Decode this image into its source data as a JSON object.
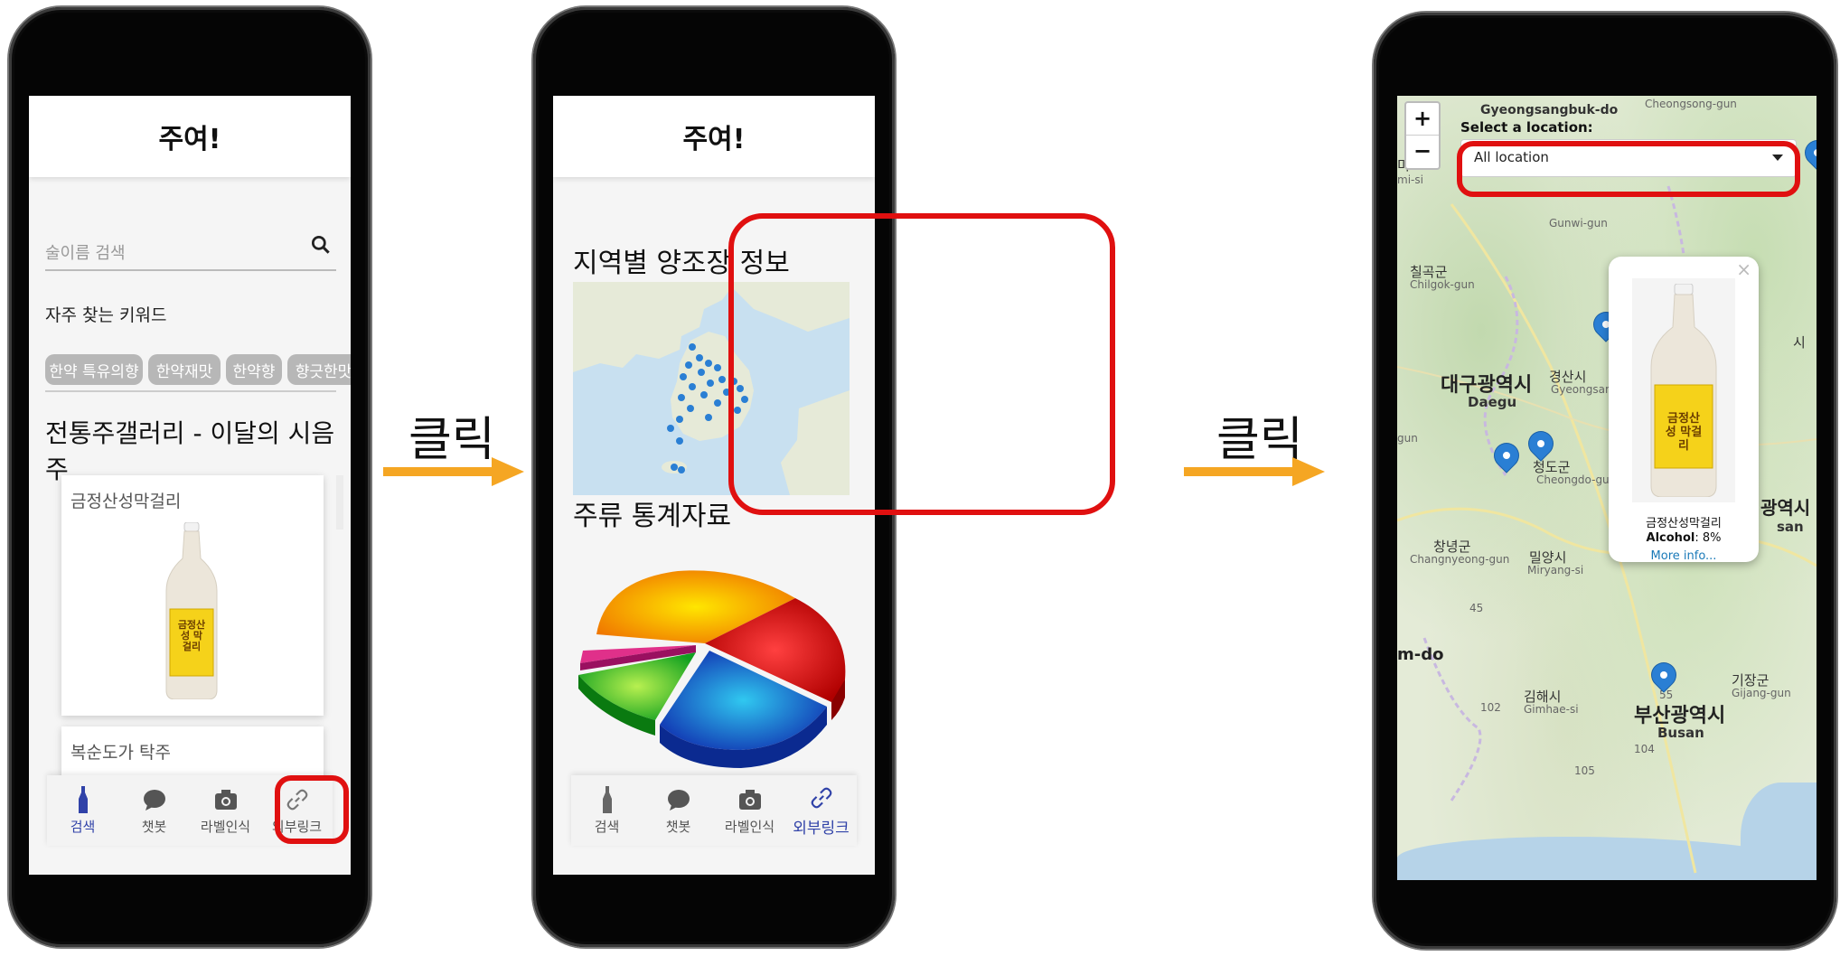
{
  "arrows": {
    "label": "클릭",
    "color": "#f5a623"
  },
  "app": {
    "title": "주여!"
  },
  "nav": {
    "search": "검색",
    "chatbot": "챗봇",
    "label_recognition": "라벨인식",
    "external_link": "외부링크"
  },
  "phone1": {
    "search_placeholder": "술이름 검색",
    "keywords_title": "자주 찾는 키워드",
    "keywords": [
      "한약 특유의향",
      "한약재맛",
      "한약향",
      "향긋한맛"
    ],
    "gallery_title": "전통주갤러리 - 이달의 시음주",
    "cards": [
      "금정산성막걸리",
      "복순도가 탁주"
    ],
    "bottle_label": "금정산성 막걸리"
  },
  "phone2": {
    "region_title": "지역별 양조장 정보",
    "stats_title": "주류 통계자료"
  },
  "phone3": {
    "zoom_in": "+",
    "zoom_out": "−",
    "select_label": "Select a location:",
    "select_value": "All location",
    "popup": {
      "name": "금정산성막걸리",
      "alcohol_label": "Alcohol",
      "alcohol_value": ": 8%",
      "more": "More info...",
      "close": "×"
    },
    "map_labels": {
      "gyeongsangbuk": "Gyeongsangbuk-do",
      "cheongsong": "Cheongsong-gun",
      "gunwi": "Gunwi-gun",
      "chilgok_ko": "칠곡군",
      "chilgok_en": "Chilgok-gun",
      "daegu_ko": "대구광역시",
      "daegu_en": "Daegu",
      "gyeongsan_ko": "경산시",
      "gyeongsan_en": "Gyeongsan",
      "cheongdo_ko": "청도군",
      "cheongdo_en": "Cheongdo-gun",
      "changnyeong_ko": "창녕군",
      "changnyeong_en": "Changnyeong-gun",
      "miryang_ko": "밀양시",
      "miryang_en": "Miryang-si",
      "gimhae_ko": "김해시",
      "gimhae_en": "Gimhae-si",
      "busan_ko": "부산광역시",
      "busan_en": "Busan",
      "gijang_ko": "기장군",
      "gijang_en": "Gijang-gun",
      "ulsan_ko": "광역시",
      "ulsan_en": "san",
      "mdo": "m-do",
      "misi": "mi-si",
      "mi": "미",
      "si": "시",
      "gun": "gun",
      "road_45": "45",
      "road_104": "104",
      "road_55": "55",
      "road_102": "102",
      "road_105": "105"
    }
  }
}
